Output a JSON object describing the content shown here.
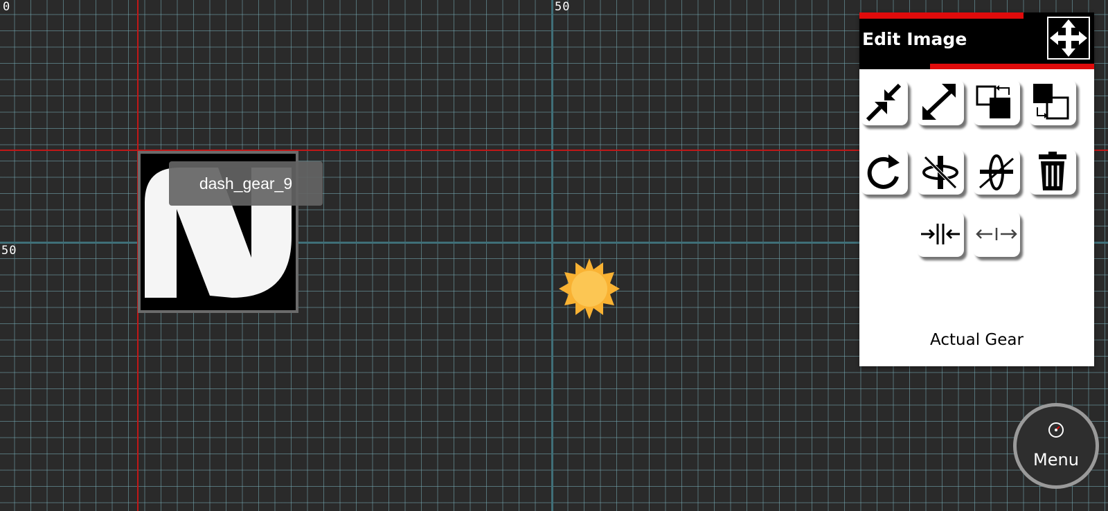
{
  "ruler": {
    "top_left": "0",
    "top_mid": "50",
    "left_mid": "50"
  },
  "canvas": {
    "image_tooltip": "dash_gear_9",
    "image_letter": "N",
    "accent_red": "#c01818",
    "grid_color": "#3f6f78",
    "background": "#2a2a2a"
  },
  "panel": {
    "title": "Edit Image",
    "accent": "#e00b0b",
    "move_icon": "move-arrows-icon",
    "tools": [
      {
        "name": "shrink",
        "icon": "shrink-arrows-icon"
      },
      {
        "name": "enlarge",
        "icon": "expand-arrows-icon"
      },
      {
        "name": "bring-forward",
        "icon": "bring-forward-icon"
      },
      {
        "name": "send-backward",
        "icon": "send-backward-icon"
      },
      {
        "name": "rotate",
        "icon": "rotate-icon"
      },
      {
        "name": "flip-horizontal",
        "icon": "flip-horizontal-icon"
      },
      {
        "name": "flip-vertical",
        "icon": "flip-vertical-icon"
      },
      {
        "name": "delete",
        "icon": "trash-icon"
      },
      {
        "name": "center-horizontal",
        "icon": "center-horizontal-icon"
      },
      {
        "name": "spread-horizontal",
        "icon": "spread-horizontal-icon"
      }
    ],
    "footer_label": "Actual Gear"
  },
  "menu": {
    "label": "Menu",
    "icon": "speedometer-icon"
  }
}
